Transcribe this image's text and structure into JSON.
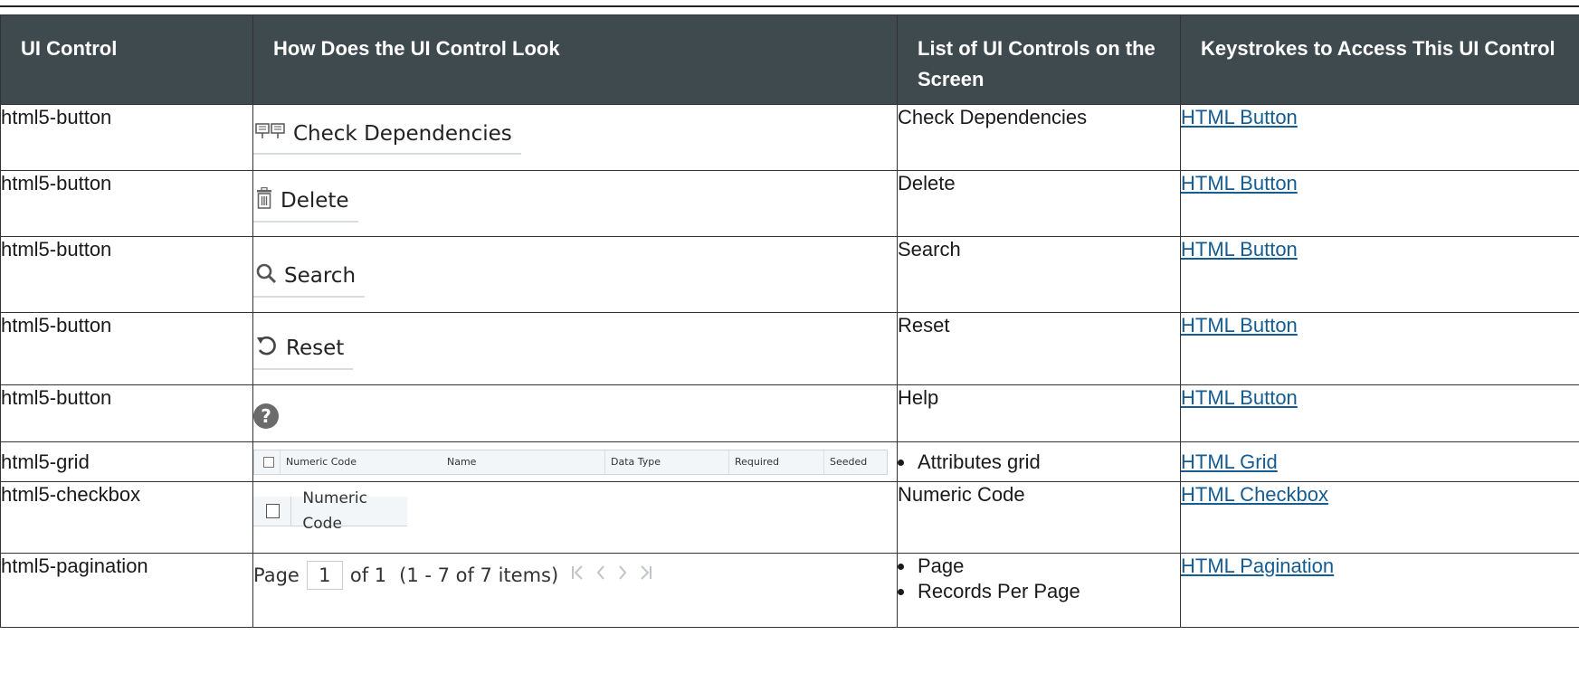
{
  "headers": [
    "UI Control",
    "How Does the UI Control Look",
    "List of UI Controls on the Screen",
    "Keystrokes to Access This UI Control"
  ],
  "rows": [
    {
      "control": "html5-button",
      "look_label": "Check Dependencies",
      "list": "Check Dependencies",
      "link": "HTML Button"
    },
    {
      "control": "html5-button",
      "look_label": "Delete",
      "list": "Delete",
      "link": "HTML Button"
    },
    {
      "control": "html5-button",
      "look_label": "Search",
      "list": "Search",
      "link": "HTML Button"
    },
    {
      "control": "html5-button",
      "look_label": "Reset",
      "list": "Reset",
      "link": "HTML Button"
    },
    {
      "control": "html5-button",
      "look_label": "?",
      "list": "Help",
      "link": "HTML Button"
    },
    {
      "control": "html5-grid",
      "grid_columns": [
        "Numeric Code",
        "Name",
        "Data Type",
        "Required",
        "Seeded"
      ],
      "list_items": [
        "Attributes grid"
      ],
      "link": "HTML Grid"
    },
    {
      "control": "html5-checkbox",
      "look_label": "Numeric Code",
      "list": "Numeric Code",
      "link": "HTML Checkbox"
    },
    {
      "control": "html5-pagination",
      "pagination": {
        "page_label": "Page",
        "page_value": "1",
        "of_text": "of 1",
        "range_text": "(1 - 7 of  7  items)"
      },
      "list_items": [
        "Page",
        "Records Per Page"
      ],
      "link": "HTML Pagination"
    }
  ],
  "icons": [
    "check-dependencies-icon",
    "trash-icon",
    "search-icon",
    "reset-icon",
    "help-icon",
    "first-page-icon",
    "prev-page-icon",
    "next-page-icon",
    "last-page-icon"
  ]
}
